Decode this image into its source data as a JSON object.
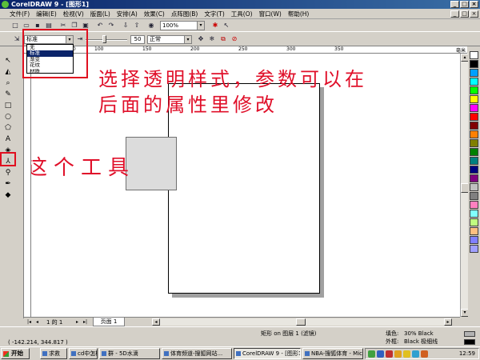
{
  "window": {
    "title": "CorelDRAW 9 - [图形1]",
    "btn_min": "_",
    "btn_max": "□",
    "btn_close": "×"
  },
  "menu": {
    "items": [
      "文件(F)",
      "编辑(E)",
      "检视(V)",
      "版面(L)",
      "安排(A)",
      "效果(C)",
      "点阵图(B)",
      "文字(T)",
      "工具(O)",
      "窗口(W)",
      "帮助(H)"
    ]
  },
  "toolbar": {
    "zoom_value": "100%",
    "zoom_arrow": "▾"
  },
  "property_bar": {
    "transparency_style": "标准",
    "opacity_value": "50",
    "merge_mode": "正常",
    "arrow": "▾"
  },
  "transparency_dropdown": {
    "options": [
      "无",
      "标准",
      "渐变",
      "花纹",
      "材质"
    ],
    "selected_index": 1
  },
  "ruler": {
    "h_labels": [
      "50",
      "100",
      "150",
      "200",
      "250",
      "300",
      "350"
    ],
    "unit": "毫米"
  },
  "annotations": {
    "line1": "选择透明样式，参数可以在",
    "line2": "后面的属性里修改",
    "tool_note": "这个工具"
  },
  "palette": {
    "colors": [
      "#ffffff",
      "#000000",
      "#00a0ff",
      "#00ffff",
      "#00ff00",
      "#ffff00",
      "#ff00ff",
      "#ff0000",
      "#800000",
      "#ff8000",
      "#808000",
      "#008000",
      "#008080",
      "#000080",
      "#800080",
      "#c0c0c0",
      "#808080",
      "#ff80c0",
      "#80ffff",
      "#c0ff80",
      "#ffc080",
      "#8080ff",
      "#a0a0ff"
    ]
  },
  "page_bar": {
    "first": "|◂",
    "prev": "◂",
    "position": "1 的 1",
    "next": "▸",
    "last": "▸|",
    "tab_label": "页面 1"
  },
  "status": {
    "object_info": "矩形 on 图层 1  (滤镜)",
    "coordinates": "( -142.214, 344.817 )",
    "fill_label": "填色:",
    "fill_value": "30% Black",
    "outline_label": "外框:",
    "outline_value": "Black  极细线",
    "fill_color": "#b3b3b3",
    "outline_color": "#000000"
  },
  "taskbar": {
    "start": "开始",
    "tasks": [
      "求救",
      "cd中怎样设...",
      "群 - 5D水滴",
      "体育频道-搜狐网站...",
      "CorelDRAW 9 - [图形1]",
      "NBA-搜狐体育 - Micr..."
    ],
    "active_index": 4,
    "clock": "12:59"
  }
}
